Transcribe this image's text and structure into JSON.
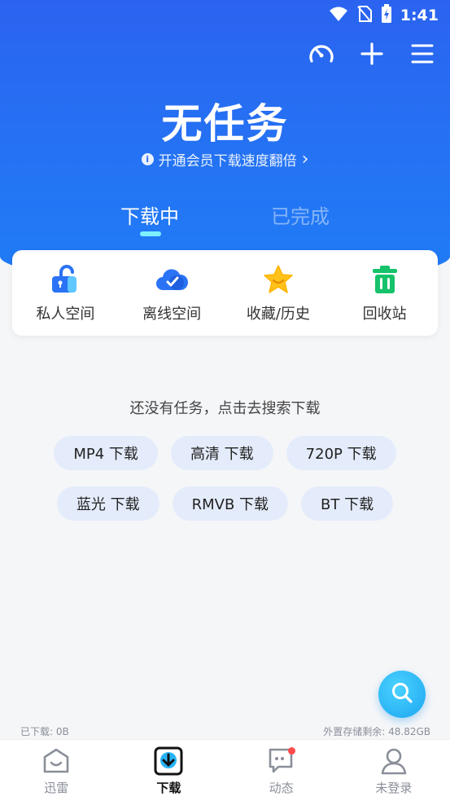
{
  "status_bar": {
    "time": "1:41"
  },
  "hero": {
    "title": "无任务",
    "vip_link": "开通会员下载速度翻倍",
    "vip_arrow": "›",
    "info_glyph": "i"
  },
  "tabs": [
    {
      "label": "下载中",
      "active": true
    },
    {
      "label": "已完成",
      "active": false
    }
  ],
  "quick_actions": [
    {
      "label": "私人空间",
      "icon": "lock-icon"
    },
    {
      "label": "离线空间",
      "icon": "cloud-icon"
    },
    {
      "label": "收藏/历史",
      "icon": "star-icon"
    },
    {
      "label": "回收站",
      "icon": "trash-icon"
    }
  ],
  "empty": {
    "hint": "还没有任务，点击去搜索下载"
  },
  "chips": {
    "row1": [
      "MP4 下载",
      "高清 下载",
      "720P 下载"
    ],
    "row2": [
      "蓝光 下载",
      "RMVB 下载",
      "BT 下载"
    ]
  },
  "storage": {
    "downloaded": "已下载: 0B",
    "remaining": "外置存储剩余: 48.82GB"
  },
  "bottom_nav": [
    {
      "label": "迅雷",
      "icon": "home-icon",
      "active": false
    },
    {
      "label": "下载",
      "icon": "download-icon",
      "active": true
    },
    {
      "label": "动态",
      "icon": "chat-icon",
      "active": false,
      "badge": true
    },
    {
      "label": "未登录",
      "icon": "user-icon",
      "active": false
    }
  ],
  "colors": {
    "header_blue": "#2474f4",
    "tab_indicator": "#7ff0ff",
    "chip_bg": "#e4ecfb",
    "fab": "#1ba6f0",
    "badge_red": "#ff4b4b"
  }
}
